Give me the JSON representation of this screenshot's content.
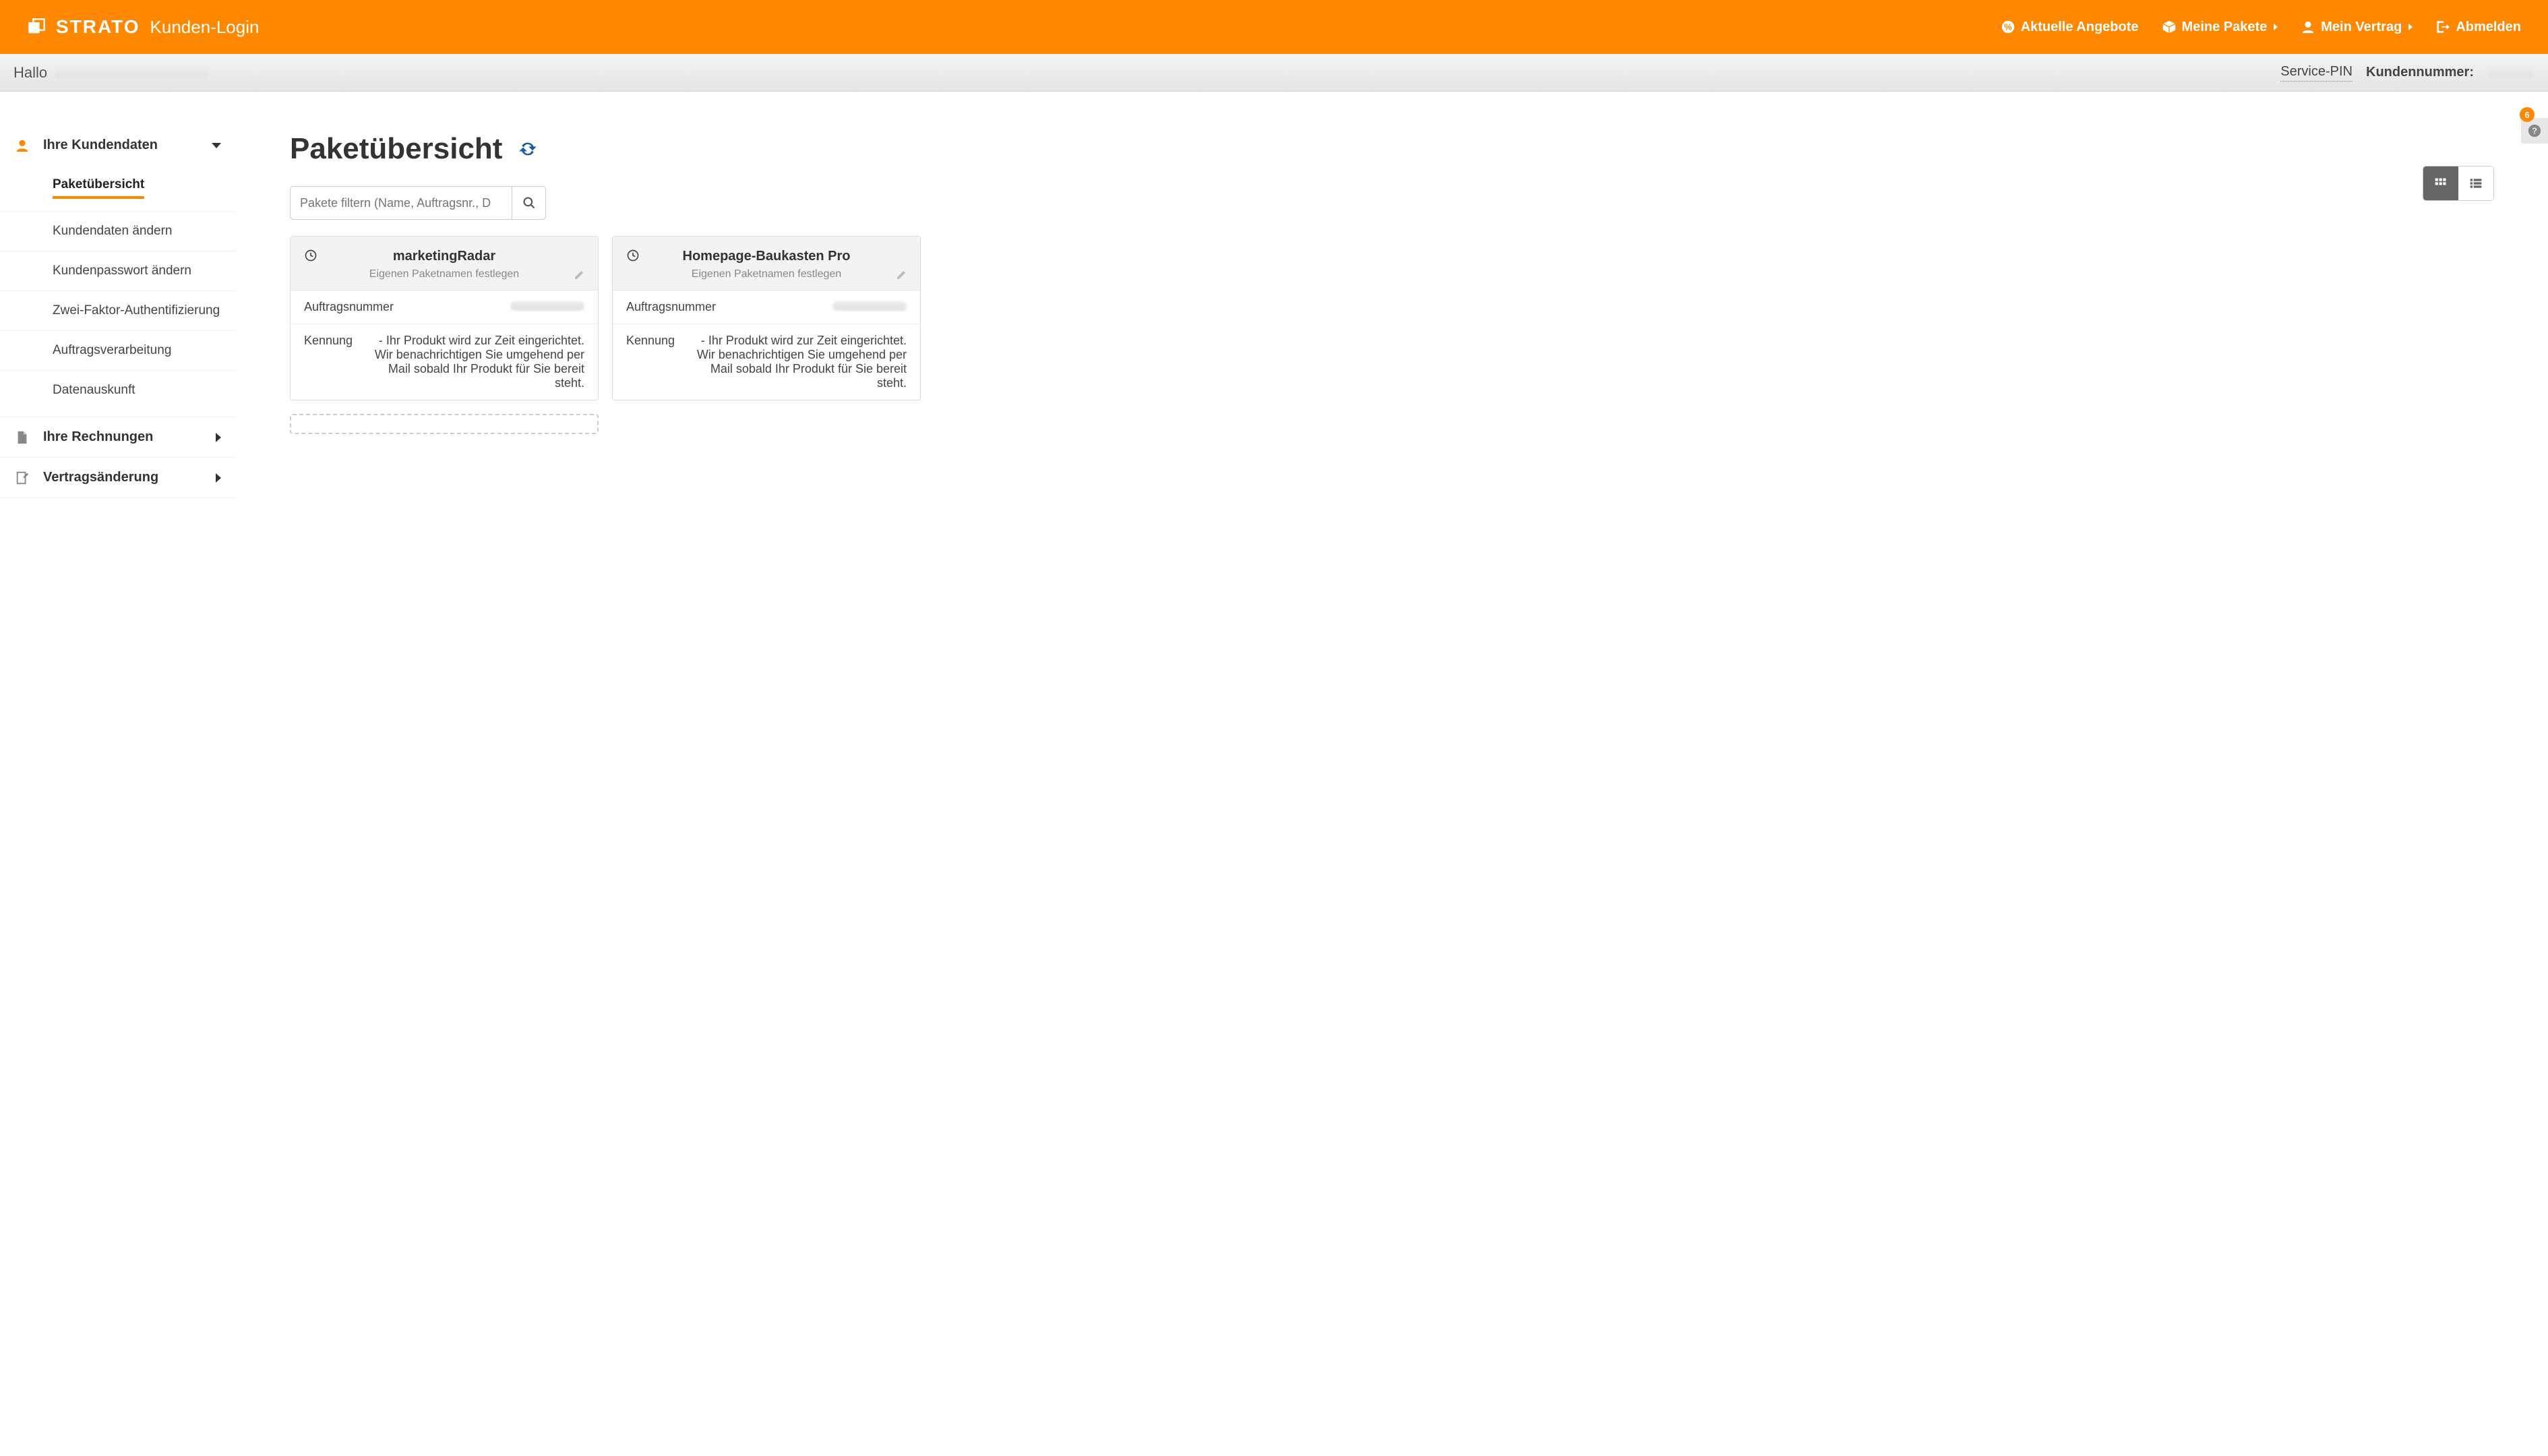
{
  "header": {
    "brand": "STRATO",
    "subtitle": "Kunden-Login",
    "nav": {
      "offers": "Aktuelle Angebote",
      "packages": "Meine Pakete",
      "contract": "Mein Vertrag",
      "logout": "Abmelden"
    }
  },
  "greet": {
    "hello": "Hallo",
    "service_pin": "Service-PIN",
    "customer_no_label": "Kundennummer:"
  },
  "sidebar": {
    "customer_data": {
      "title": "Ihre Kundendaten",
      "items": [
        "Paketübersicht",
        "Kundendaten ändern",
        "Kundenpasswort ändern",
        "Zwei-Faktor-Authentifizierung",
        "Auftragsverarbeitung",
        "Datenauskunft"
      ]
    },
    "invoices": "Ihre Rechnungen",
    "contract_change": "Vertragsänderung"
  },
  "main": {
    "title": "Paketübersicht",
    "filter_placeholder": "Pakete filtern (Name, Auftragsnr., D"
  },
  "cards": [
    {
      "title": "marketingRadar",
      "subtitle": "Eigenen Paketnamen festlegen",
      "order_label": "Auftragsnummer",
      "ident_label": "Kennung",
      "ident_text": "- Ihr Produkt wird zur Zeit eingerichtet. Wir benachrichtigen Sie umgehend per Mail sobald Ihr Produkt für Sie bereit steht."
    },
    {
      "title": "Homepage-Baukasten Pro",
      "subtitle": "Eigenen Paketnamen festlegen",
      "order_label": "Auftragsnummer",
      "ident_label": "Kennung",
      "ident_text": "- Ihr Produkt wird zur Zeit eingerichtet. Wir benachrichtigen Sie umgehend per Mail sobald Ihr Produkt für Sie bereit steht."
    }
  ],
  "help": {
    "badge": "6"
  }
}
